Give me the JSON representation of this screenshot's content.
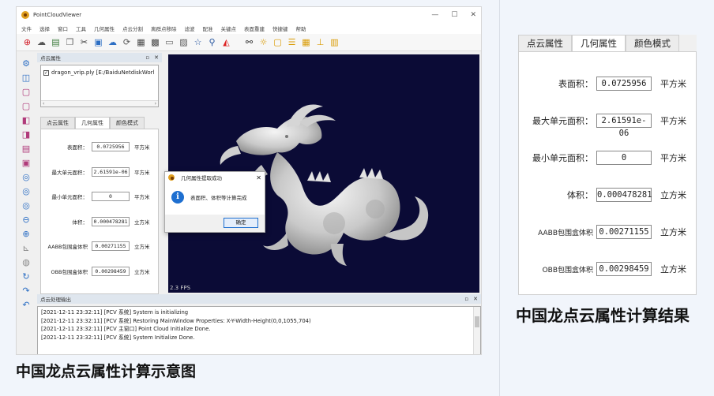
{
  "app": {
    "title": "PointCloudViewer",
    "window_controls": [
      "—",
      "☐",
      "✕"
    ],
    "menu": [
      "文件",
      "选择",
      "窗口",
      "工具",
      "几何属性",
      "点云分割",
      "离群点移除",
      "滤波",
      "配准",
      "关键点",
      "表面重建",
      "快捷键",
      "帮助"
    ]
  },
  "cloud_panel": {
    "title": "点云属性",
    "file_item": "dragon_vrip.ply [E:/BaiduNetdiskWorl",
    "tabs": [
      "点云属性",
      "几何属性",
      "颜色模式"
    ],
    "active_tab": 1
  },
  "properties_small": [
    {
      "label": "表面积：",
      "value": "0.0725956",
      "unit": "平方米"
    },
    {
      "label": "最大单元面积：",
      "value": "2.61591e-06",
      "unit": "平方米"
    },
    {
      "label": "最小单元面积：",
      "value": "0",
      "unit": "平方米"
    },
    {
      "label": "体积：",
      "value": "0.000478281",
      "unit": "立方米"
    },
    {
      "label": "AABB包围盒体积",
      "value": "0.00271155",
      "unit": "立方米"
    },
    {
      "label": "OBB包围盒体积",
      "value": "0.00298459",
      "unit": "立方米"
    }
  ],
  "viewport": {
    "fps": "2.3 FPS"
  },
  "dialog": {
    "title": "几何属性提取成功",
    "message": "表面积、体积等计算完成",
    "ok_label": "确定"
  },
  "console": {
    "title": "点云处理输出",
    "lines": [
      "[2021-12-11 23:32:11] [PCV 系统] System is initializing",
      "[2021-12-11 23:32:11] [PCV 系统] Restoring MainWindow Properties: X-Y-Width-Height(0,0,1055,704)",
      "[2021-12-11 23:32:11] [PCV 主窗口] Point Cloud Initialize Done.",
      "[2021-12-11 23:32:11] [PCV 系统] System Initialize Done."
    ]
  },
  "caption_left": "中国龙点云属性计算示意图",
  "zoom_panel": {
    "tabs": [
      "点云属性",
      "几何属性",
      "颜色模式"
    ],
    "active_tab": 1,
    "rows": [
      {
        "label": "表面积：",
        "value": "0.0725956",
        "unit": "平方米"
      },
      {
        "label": "最大单元面积：",
        "value": "2.61591e-06",
        "unit": "平方米"
      },
      {
        "label": "最小单元面积：",
        "value": "0",
        "unit": "平方米"
      },
      {
        "label": "体积：",
        "value": "0.000478281",
        "unit": "立方米"
      },
      {
        "label": "AABB包围盒体积",
        "value": "0.00271155",
        "unit": "立方米"
      },
      {
        "label": "OBB包围盒体积",
        "value": "0.00298459",
        "unit": "立方米"
      }
    ]
  },
  "caption_right": "中国龙点云属性计算结果",
  "colors": {
    "viewport_bg": "#0b0b36",
    "dock_header": "#dfe6ee",
    "accent": "#1e6fd0"
  }
}
